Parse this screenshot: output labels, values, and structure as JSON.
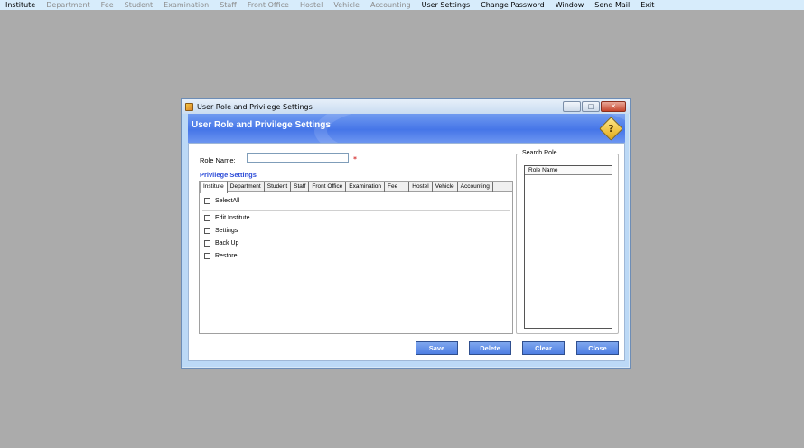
{
  "menubar": {
    "items": [
      {
        "label": "Institute",
        "enabled": true
      },
      {
        "label": "Department",
        "enabled": false
      },
      {
        "label": "Fee",
        "enabled": false
      },
      {
        "label": "Student",
        "enabled": false
      },
      {
        "label": "Examination",
        "enabled": false
      },
      {
        "label": "Staff",
        "enabled": false
      },
      {
        "label": "Front Office",
        "enabled": false
      },
      {
        "label": "Hostel",
        "enabled": false
      },
      {
        "label": "Vehicle",
        "enabled": false
      },
      {
        "label": "Accounting",
        "enabled": false
      },
      {
        "label": "User Settings",
        "enabled": true
      },
      {
        "label": "Change Password",
        "enabled": true
      },
      {
        "label": "Window",
        "enabled": true
      },
      {
        "label": "Send Mail",
        "enabled": true
      },
      {
        "label": "Exit",
        "enabled": true
      }
    ]
  },
  "window": {
    "title": "User Role and Privilege Settings",
    "controls": {
      "minimize": "–",
      "maximize": "□",
      "close": "✕"
    }
  },
  "banner": {
    "title": "User Role and Privilege Settings",
    "help_glyph": "?"
  },
  "form": {
    "role_label": "Role  Name:",
    "role_value": "",
    "required_marker": "*",
    "privilege_title": "Privilege Settings"
  },
  "tabs": [
    {
      "label": "Institute",
      "active": true
    },
    {
      "label": "Department",
      "active": false
    },
    {
      "label": "Student",
      "active": false
    },
    {
      "label": "Staff",
      "active": false
    },
    {
      "label": "Front Office",
      "active": false
    },
    {
      "label": "Examination",
      "active": false
    },
    {
      "label": "Fee",
      "active": false
    },
    {
      "label": "Hostel",
      "active": false
    },
    {
      "label": "Vehicle",
      "active": false
    },
    {
      "label": "Accounting",
      "active": false
    }
  ],
  "privileges": {
    "select_all": {
      "label": "SelectAll",
      "checked": false
    },
    "items": [
      {
        "label": "Edit Institute",
        "checked": false
      },
      {
        "label": "Settings",
        "checked": false
      },
      {
        "label": "Back Up",
        "checked": false
      },
      {
        "label": "Restore",
        "checked": false
      }
    ]
  },
  "search": {
    "legend": "Search Role",
    "column_header": "Role Name"
  },
  "buttons": {
    "save": "Save",
    "delete": "Delete",
    "clear": "Clear",
    "close": "Close"
  },
  "colors": {
    "desktop": "#ababab",
    "menubar": "#d7ecfb",
    "banner": "#4676e8",
    "button": "#5d89e6",
    "privilege_title": "#2b4bd8",
    "required": "#cc0000"
  }
}
